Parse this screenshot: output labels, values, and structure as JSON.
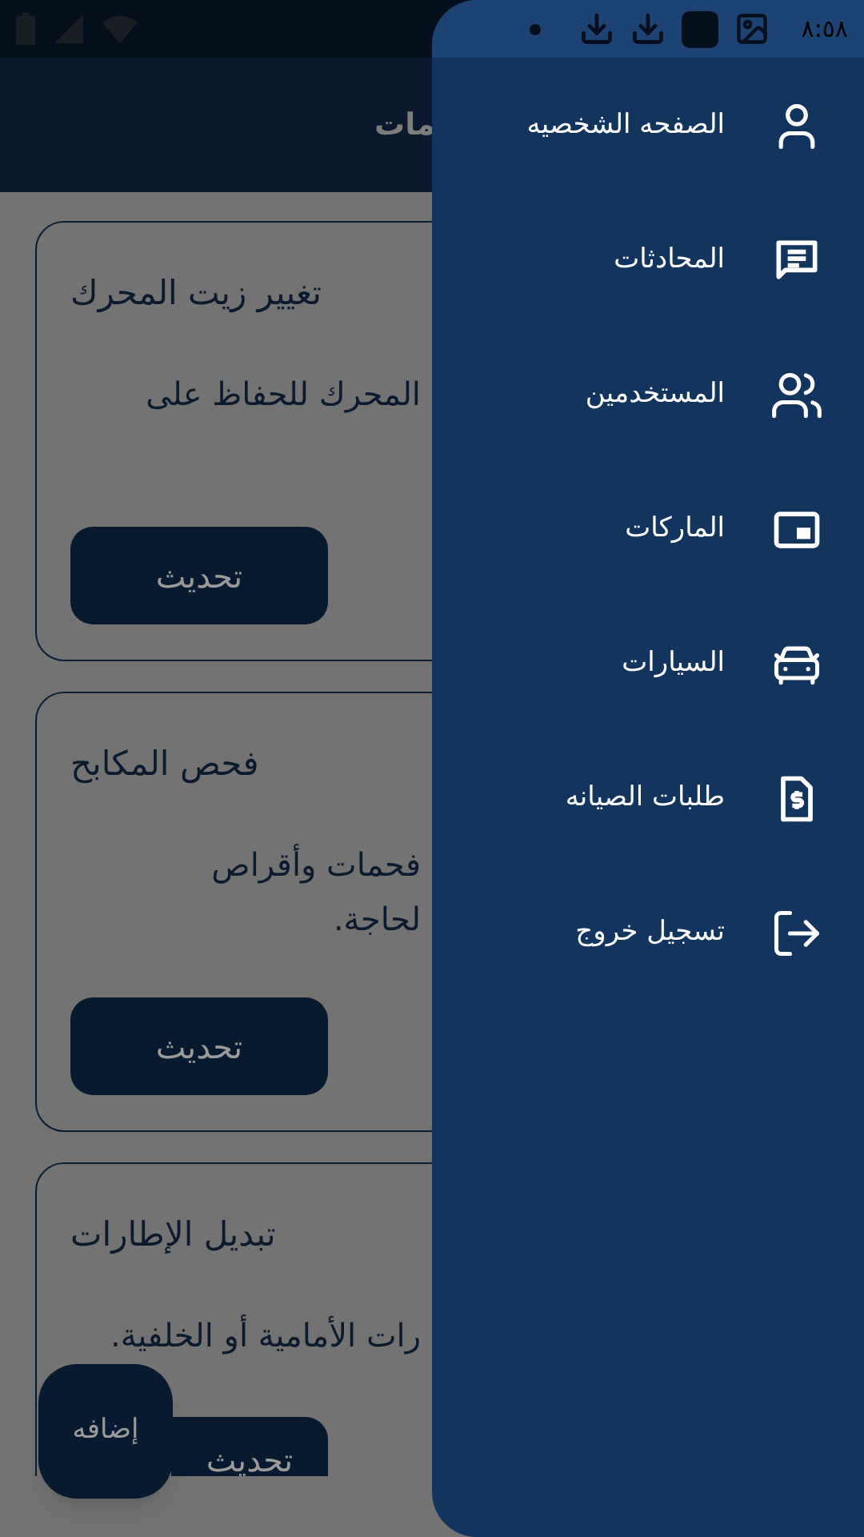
{
  "status_bar": {
    "time": "٨:٥٨"
  },
  "header": {
    "title": "مات"
  },
  "cards": [
    {
      "title": "تغيير زيت المحرك",
      "description_lines": [
        "المحرك للحفاظ على"
      ],
      "button": "تحديث"
    },
    {
      "title": "فحص المكابح",
      "description_lines": [
        "فحمات وأقراص",
        "لحاجة."
      ],
      "button": "تحديث"
    },
    {
      "title": "تبديل الإطارات",
      "description_lines": [
        "رات الأمامية أو الخلفية."
      ],
      "button": "تحديث"
    }
  ],
  "fab": {
    "label": "إضافه"
  },
  "drawer": {
    "items": [
      {
        "label": "الصفحه الشخصيه"
      },
      {
        "label": "المحادثات"
      },
      {
        "label": "المستخدمين"
      },
      {
        "label": "الماركات"
      },
      {
        "label": "السيارات"
      },
      {
        "label": "طلبات الصيانه"
      },
      {
        "label": "تسجيل خروج"
      }
    ]
  }
}
